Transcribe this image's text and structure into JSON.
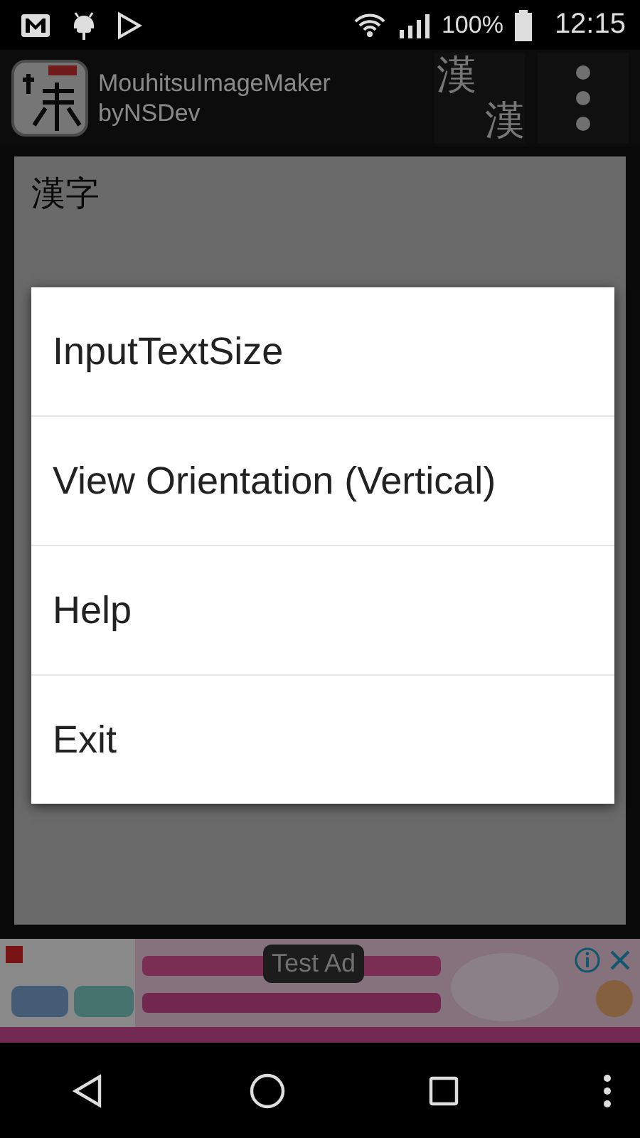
{
  "status_bar": {
    "battery": "100%",
    "time": "12:15"
  },
  "app_bar": {
    "title": "MouhitsuImageMaker",
    "subtitle": "byNSDev",
    "swap_button": {
      "top": "漢",
      "bottom": "漢"
    }
  },
  "editor": {
    "text": "漢字"
  },
  "menu": {
    "items": [
      {
        "label": "InputTextSize"
      },
      {
        "label": "View Orientation (Vertical)"
      },
      {
        "label": "Help"
      },
      {
        "label": "Exit"
      }
    ]
  },
  "ad": {
    "badge": "Test Ad"
  }
}
